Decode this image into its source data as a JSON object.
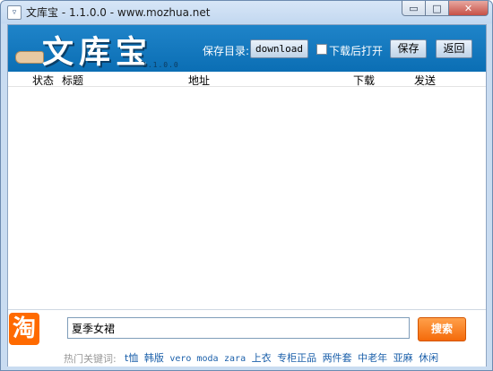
{
  "window": {
    "title": "文库宝 - 1.1.0.0 - www.mozhua.net",
    "icon": "app-icon",
    "buttons": {
      "minimize": "▭",
      "maximize": "□",
      "close": "✕"
    }
  },
  "header": {
    "logo_text": "文库宝",
    "version": "1.1.0.0",
    "save_dir_label": "保存目录:",
    "download_btn": "download",
    "open_after_download": {
      "label": "下载后打开",
      "checked": false
    },
    "save_btn": "保存",
    "back_btn": "返回"
  },
  "table": {
    "columns": [
      "状态",
      "标题",
      "地址",
      "下载",
      "发送"
    ],
    "rows": []
  },
  "search": {
    "logo_char": "淘",
    "value": "夏季女裙",
    "button": "搜索"
  },
  "hot_keywords": {
    "label": "热门关键词:",
    "items": [
      "t恤",
      "韩版",
      "vero moda",
      "zara",
      "上衣",
      "专柜正品",
      "两件套",
      "中老年",
      "亚麻",
      "休闲"
    ]
  },
  "colors": {
    "header_blue": "#1478c0",
    "search_orange": "#f57b1c",
    "taobao_orange": "#ff6a00"
  }
}
